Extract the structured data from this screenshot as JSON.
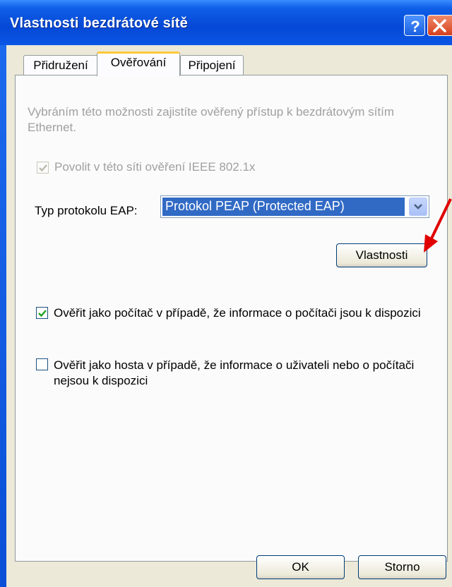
{
  "window": {
    "title": "Vlastnosti bezdrátové sítě",
    "help_icon": "question-mark-icon",
    "close_icon": "close-x-icon"
  },
  "tabs": [
    {
      "label": "Přidružení",
      "active": false
    },
    {
      "label": "Ověřování",
      "active": true
    },
    {
      "label": "Připojení",
      "active": false
    }
  ],
  "auth": {
    "description": "Vybráním této možnosti zajistíte ověřený přístup k bezdrátovým sítím Ethernet.",
    "enable_8021x": {
      "label": "Povolit v této síti ověření IEEE 802.1x",
      "checked": true,
      "disabled": true
    },
    "eap_type_label": "Typ protokolu EAP:",
    "eap_type_value": "Protokol PEAP (Protected EAP)",
    "properties_button": "Vlastnosti",
    "auth_as_computer": {
      "label": "Ověřit jako počítač v případě, že informace o počítači jsou k dispozici",
      "checked": true
    },
    "auth_as_guest": {
      "label": "Ověřit jako hosta v případě, že informace o uživateli nebo o počítači nejsou k dispozici",
      "checked": false
    }
  },
  "footer": {
    "ok_label": "OK",
    "cancel_label": "Storno"
  },
  "colors": {
    "titlebar": "#0548d6",
    "dialog_bg": "#ece9d8",
    "selection": "#316ac5",
    "annotation_arrow": "#e00000"
  }
}
